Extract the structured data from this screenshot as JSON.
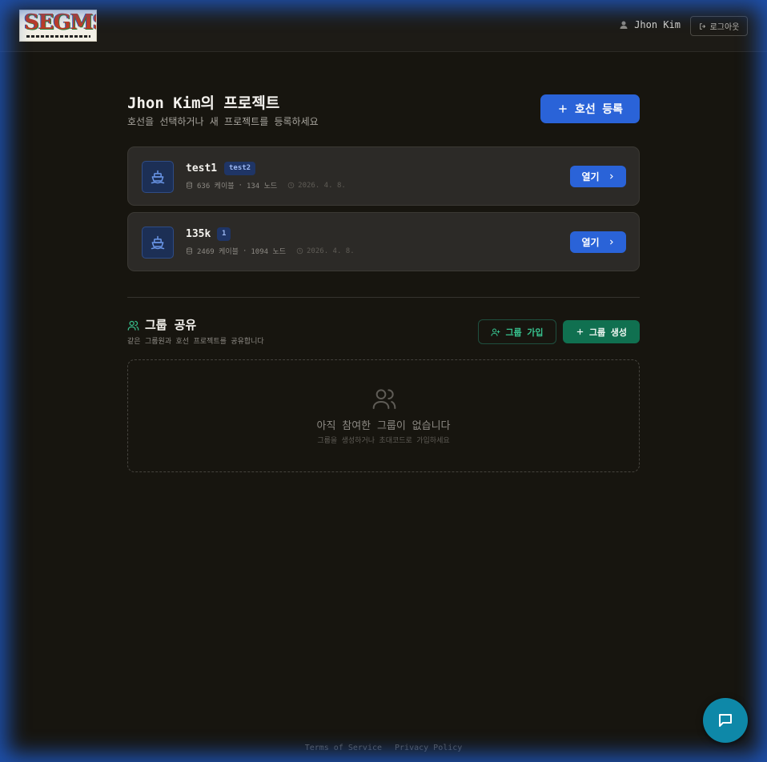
{
  "header": {
    "logo_text": "SEGMS",
    "user_name": "Jhon Kim",
    "logout_label": "로그아웃"
  },
  "main": {
    "title": "Jhon Kim의 프로젝트",
    "subtitle": "호선을 선택하거나 새 프로젝트를 등록하세요",
    "register_label": "호선 등록"
  },
  "projects": [
    {
      "name": "test1",
      "tag": "test2",
      "cables": "636 케이블",
      "separator": "·",
      "nodes": "134 노드",
      "date": "2026. 4. 8.",
      "open_label": "열기"
    },
    {
      "name": "135k",
      "tag": "1",
      "cables": "2469 케이블",
      "separator": "·",
      "nodes": "1094 노드",
      "date": "2026. 4. 8.",
      "open_label": "열기"
    }
  ],
  "groups": {
    "title": "그룹 공유",
    "subtitle": "같은 그룹원과 호선 프로젝트를 공유합니다",
    "join_label": "그룹 가입",
    "create_label": "그룹 생성",
    "empty_title": "아직 참여한 그룹이 없습니다",
    "empty_sub": "그룹을 생성하거나 초대코드로 가입하세요"
  },
  "footer": {
    "terms": "Terms of Service",
    "privacy": "Privacy Policy"
  },
  "colors": {
    "background": "#17150f",
    "primary_blue": "#2a63d8",
    "group_green": "#107050",
    "chat_teal": "#0e88a8"
  },
  "icons": [
    "user-icon",
    "logout-icon",
    "plus-icon",
    "ship-icon",
    "database-icon",
    "clock-icon",
    "chevron-right-icon",
    "users-icon",
    "user-plus-icon",
    "chat-icon"
  ]
}
